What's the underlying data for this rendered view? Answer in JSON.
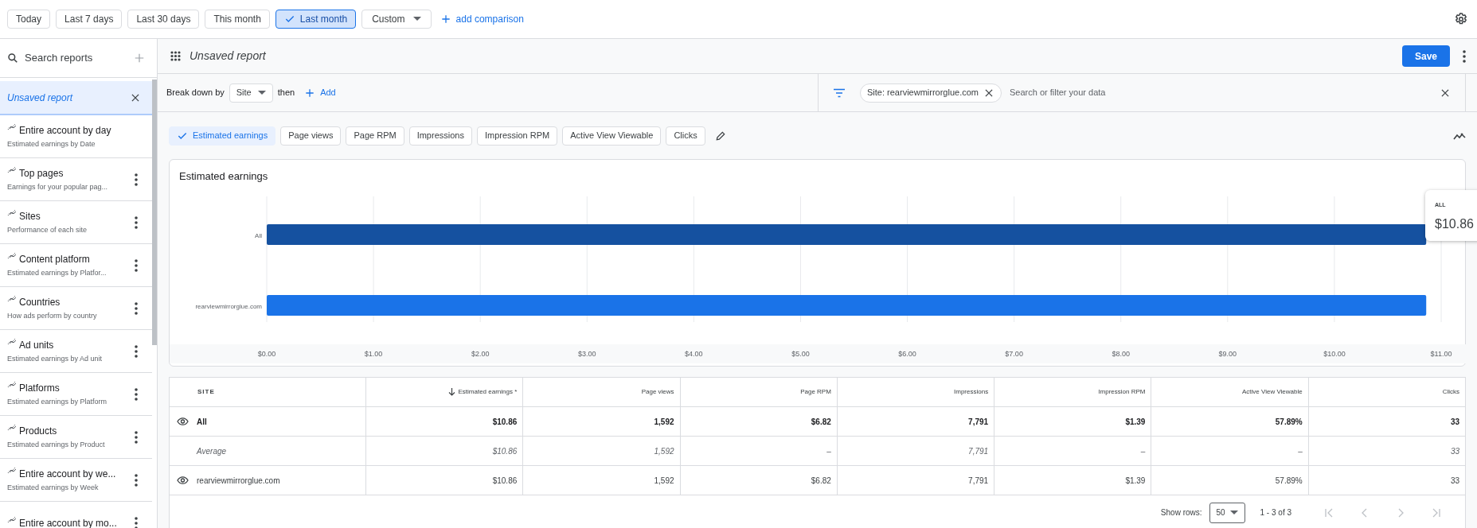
{
  "date_range": {
    "options": [
      {
        "label": "Today",
        "selected": false
      },
      {
        "label": "Last 7 days",
        "selected": false
      },
      {
        "label": "Last 30 days",
        "selected": false
      },
      {
        "label": "This month",
        "selected": false
      },
      {
        "label": "Last month",
        "selected": true
      }
    ],
    "custom": "Custom",
    "add_comparison": "add comparison"
  },
  "sidebar": {
    "search_placeholder": "Search reports",
    "current_report": {
      "title": "Unsaved report",
      "selected": true
    },
    "items": [
      {
        "title": "Entire account by day",
        "subtitle": "Estimated earnings by Date",
        "menu": false
      },
      {
        "title": "Top pages",
        "subtitle": "Earnings for your popular pag...",
        "menu": true
      },
      {
        "title": "Sites",
        "subtitle": "Performance of each site",
        "menu": true
      },
      {
        "title": "Content platform",
        "subtitle": "Estimated earnings by Platfor...",
        "menu": true
      },
      {
        "title": "Countries",
        "subtitle": "How ads perform by country",
        "menu": true
      },
      {
        "title": "Ad units",
        "subtitle": "Estimated earnings by Ad unit",
        "menu": true
      },
      {
        "title": "Platforms",
        "subtitle": "Estimated earnings by Platform",
        "menu": true
      },
      {
        "title": "Products",
        "subtitle": "Estimated earnings by Product",
        "menu": true
      },
      {
        "title": "Entire account by we...",
        "subtitle": "Estimated earnings by Week",
        "menu": true
      },
      {
        "title": "Entire account by mo...",
        "menu": true
      }
    ]
  },
  "report": {
    "title": "Unsaved report",
    "save": "Save"
  },
  "breakdown": {
    "label": "Break down by",
    "dimension": "Site",
    "then": "then",
    "add": "Add"
  },
  "filter": {
    "chips": [
      {
        "label": "Site: rearviewmirrorglue.com"
      }
    ],
    "placeholder": "Search or filter your data"
  },
  "metrics": [
    {
      "label": "Estimated earnings",
      "selected": true
    },
    {
      "label": "Page views",
      "selected": false
    },
    {
      "label": "Page RPM",
      "selected": false
    },
    {
      "label": "Impressions",
      "selected": false
    },
    {
      "label": "Impression RPM",
      "selected": false
    },
    {
      "label": "Active View Viewable",
      "selected": false
    },
    {
      "label": "Clicks",
      "selected": false
    }
  ],
  "chart": {
    "title": "Estimated earnings",
    "bar_states": [
      {
        "hovered": true
      },
      {
        "hovered": false
      }
    ],
    "chart_data": {
      "type": "bar",
      "orientation": "horizontal",
      "grid": true,
      "categories": [
        "All",
        "rearviewmirrorglue.com"
      ],
      "values": [
        10.86,
        10.86
      ],
      "xlim": [
        0,
        11
      ],
      "xticks": [
        {
          "value": 0,
          "label": "$0.00"
        },
        {
          "value": 1,
          "label": "$1.00"
        },
        {
          "value": 2,
          "label": "$2.00"
        },
        {
          "value": 3,
          "label": "$3.00"
        },
        {
          "value": 4,
          "label": "$4.00"
        },
        {
          "value": 5,
          "label": "$5.00"
        },
        {
          "value": 6,
          "label": "$6.00"
        },
        {
          "value": 7,
          "label": "$7.00"
        },
        {
          "value": 8,
          "label": "$8.00"
        },
        {
          "value": 9,
          "label": "$9.00"
        },
        {
          "value": 10,
          "label": "$10.00"
        },
        {
          "value": 11,
          "label": "$11.00"
        }
      ]
    },
    "tooltip": {
      "label": "ALL",
      "value": "$10.86"
    }
  },
  "table": {
    "columns": [
      {
        "label": "SITE",
        "sorted": false
      },
      {
        "label": "Estimated earnings *",
        "sorted": true
      },
      {
        "label": "Page views",
        "sorted": false
      },
      {
        "label": "Page RPM",
        "sorted": false
      },
      {
        "label": "Impressions",
        "sorted": false
      },
      {
        "label": "Impression RPM",
        "sorted": false
      },
      {
        "label": "Active View Viewable",
        "sorted": false
      },
      {
        "label": "Clicks",
        "sorted": false
      }
    ],
    "rows": [
      {
        "kind": "total",
        "cells": [
          "All",
          "$10.86",
          "1,592",
          "$6.82",
          "7,791",
          "$1.39",
          "57.89%",
          "33"
        ]
      },
      {
        "kind": "average",
        "cells": [
          "Average",
          "$10.86",
          "1,592",
          "–",
          "7,791",
          "–",
          "–",
          "33"
        ]
      },
      {
        "kind": "item",
        "cells": [
          "rearviewmirrorglue.com",
          "$10.86",
          "1,592",
          "$6.82",
          "7,791",
          "$1.39",
          "57.89%",
          "33"
        ]
      }
    ]
  },
  "pagination": {
    "label": "Show rows:",
    "rows_per_page": "50",
    "range": "1 - 3 of 3"
  }
}
